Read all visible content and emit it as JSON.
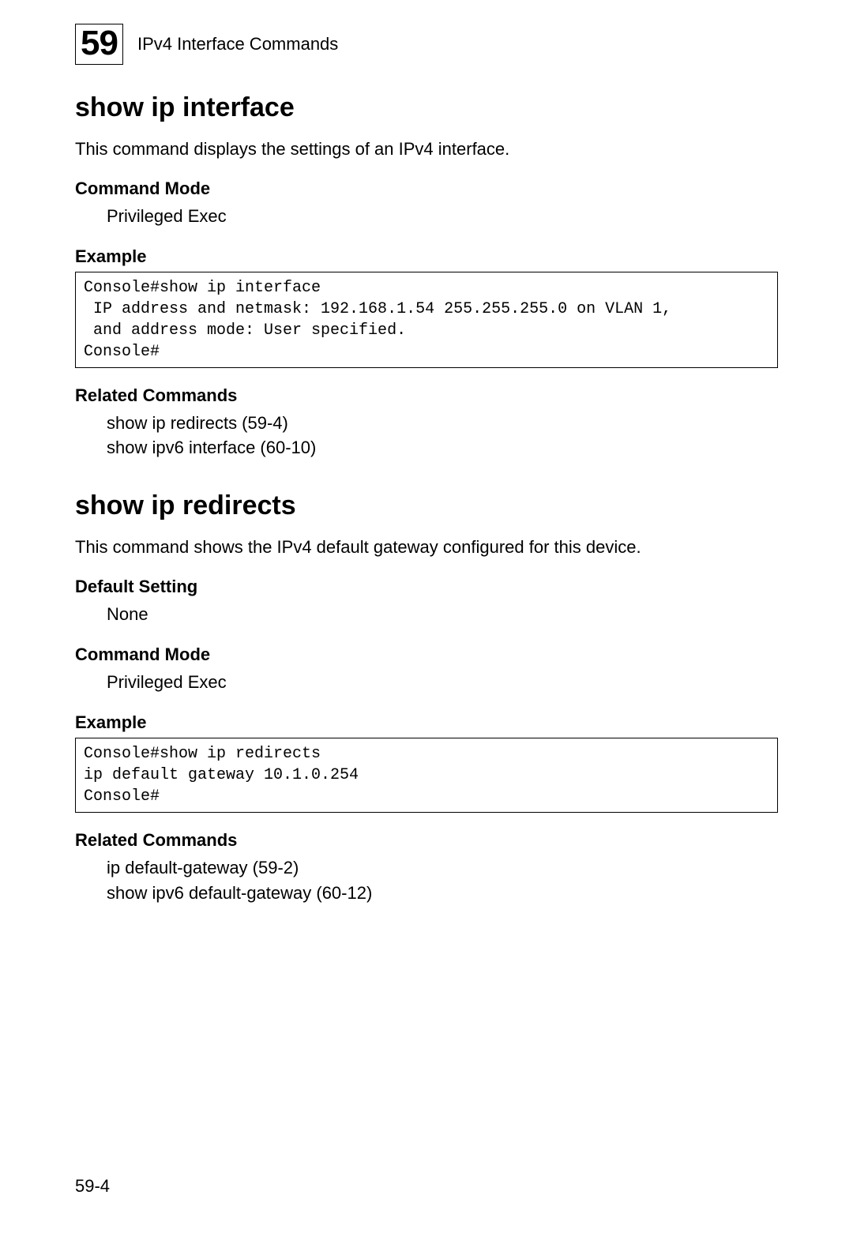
{
  "header": {
    "chapter_number": "59",
    "chapter_title": "IPv4 Interface Commands"
  },
  "sections": [
    {
      "title": "show ip interface",
      "description": "This command displays the settings of an IPv4 interface.",
      "blocks": [
        {
          "type": "labeled",
          "label": "Command Mode",
          "value": "Privileged Exec"
        },
        {
          "type": "example",
          "label": "Example",
          "code": "Console#show ip interface\n IP address and netmask: 192.168.1.54 255.255.255.0 on VLAN 1,\n and address mode: User specified.\nConsole#"
        },
        {
          "type": "related",
          "label": "Related Commands",
          "lines": [
            "show ip redirects (59-4)",
            "show ipv6 interface (60-10)"
          ]
        }
      ]
    },
    {
      "title": "show ip redirects",
      "description": "This command shows the IPv4 default gateway configured for this device.",
      "blocks": [
        {
          "type": "labeled",
          "label": "Default Setting",
          "value": "None"
        },
        {
          "type": "labeled",
          "label": "Command Mode",
          "value": "Privileged Exec"
        },
        {
          "type": "example",
          "label": "Example",
          "code": "Console#show ip redirects\nip default gateway 10.1.0.254\nConsole#"
        },
        {
          "type": "related",
          "label": "Related Commands",
          "lines": [
            "ip default-gateway (59-2)",
            "show ipv6 default-gateway (60-12)"
          ]
        }
      ]
    }
  ],
  "page_number": "59-4"
}
